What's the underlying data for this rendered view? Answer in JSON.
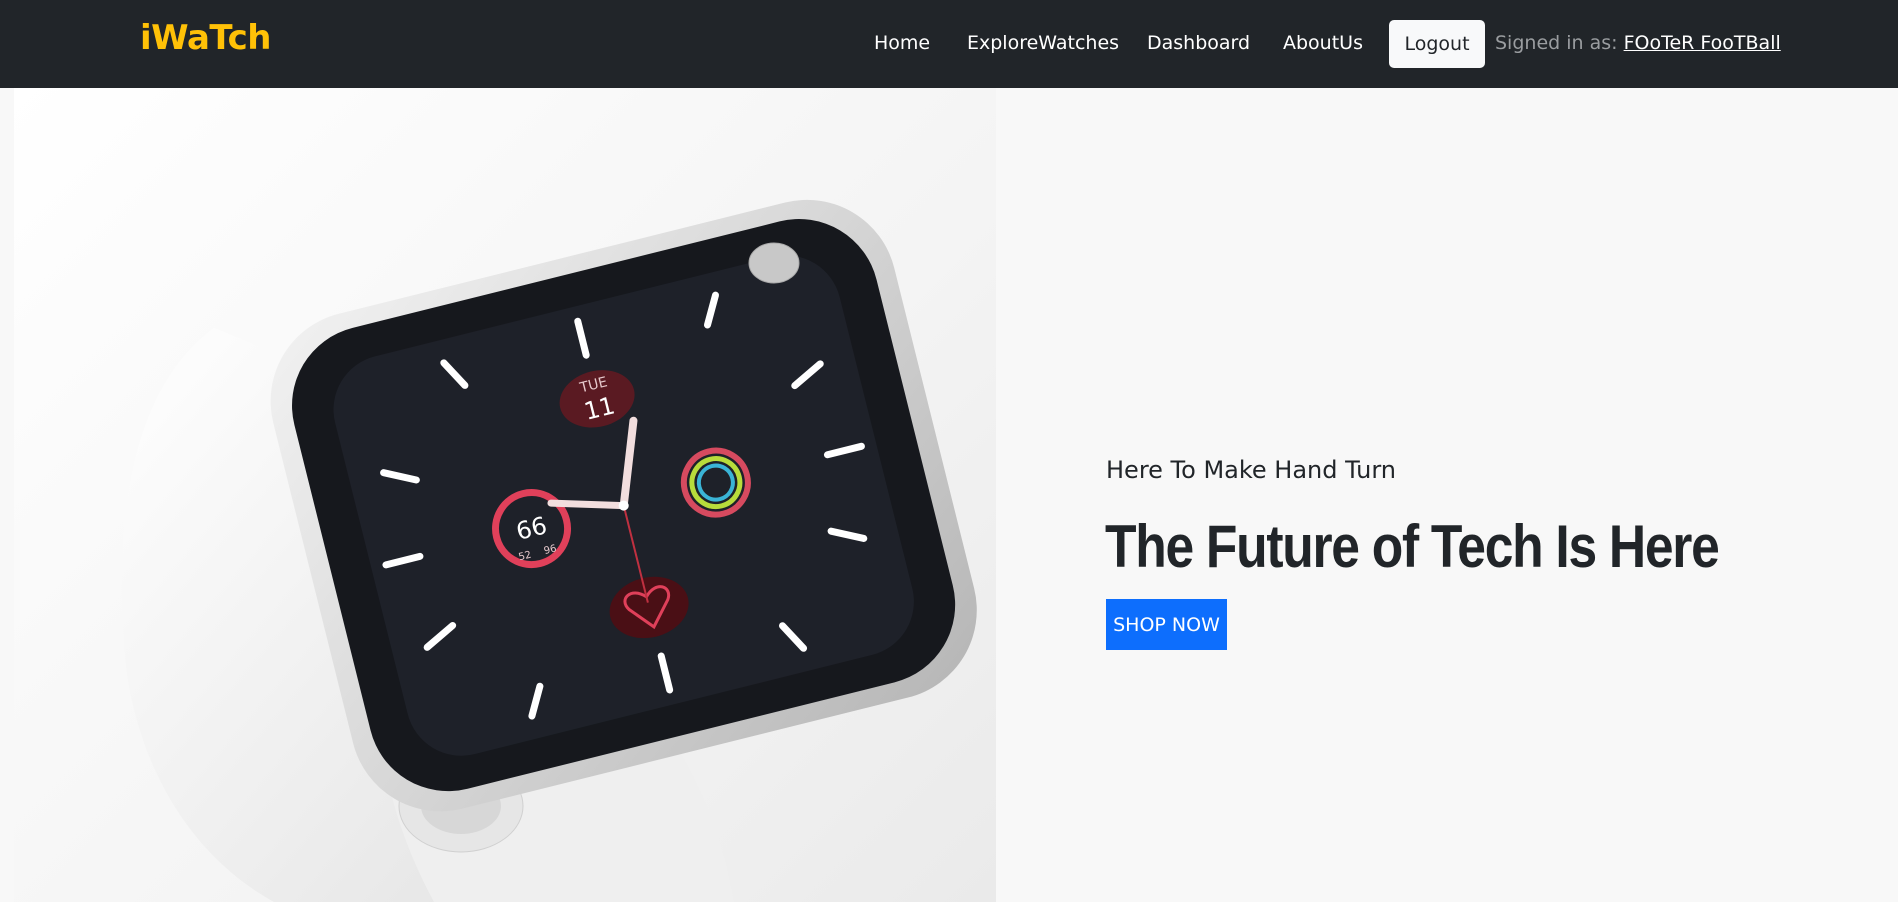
{
  "brand": {
    "name": "iWaTch",
    "color": "#ffc107"
  },
  "nav": {
    "items": [
      {
        "label": "Home"
      },
      {
        "label": "ExploreWatches"
      },
      {
        "label": "Dashboard"
      },
      {
        "label": "AboutUs"
      }
    ],
    "logout_label": "Logout",
    "signed_in_label": "Signed in as:",
    "user_name": "FOoTeR FooTBall"
  },
  "hero": {
    "image_icon": "smartwatch-image",
    "watch_face": {
      "day": "TUE",
      "date": "11",
      "ring_value": "66",
      "ring_low": "52",
      "ring_high": "96"
    },
    "tagline": "Here To Make Hand Turn",
    "headline": "The Future of Tech Is Here",
    "cta_label": "SHOP NOW",
    "cta_color": "#0d6efd"
  }
}
